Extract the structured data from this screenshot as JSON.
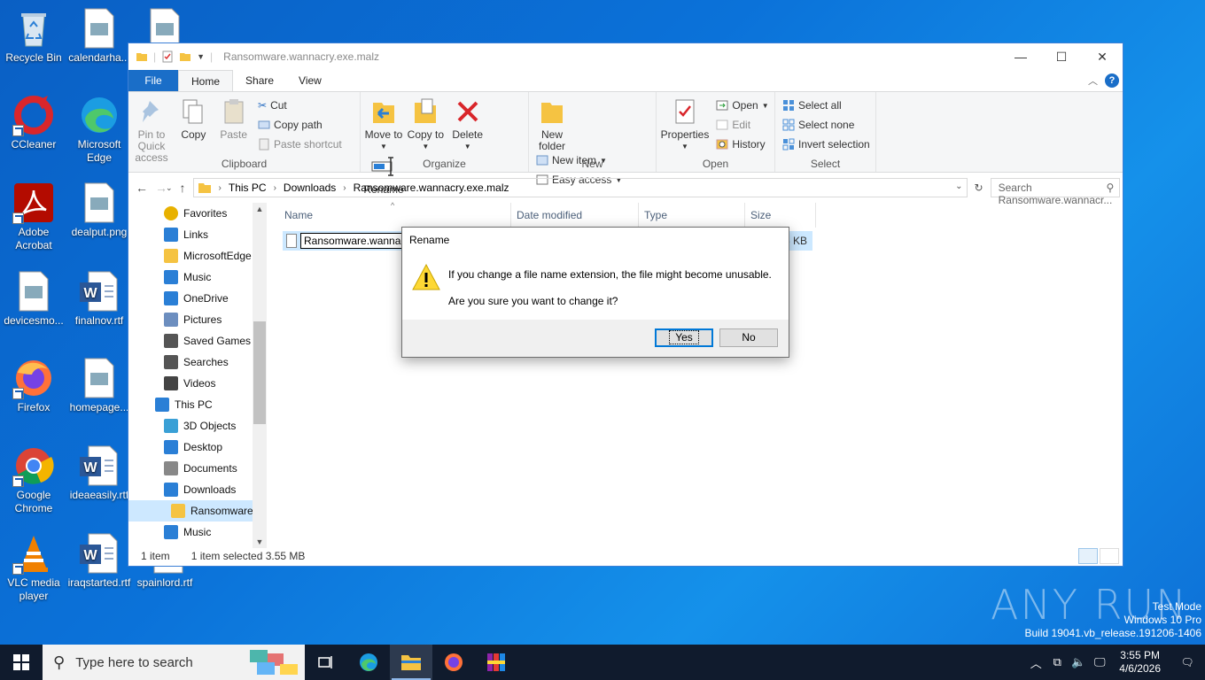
{
  "desktop": {
    "icons": [
      {
        "label": "Recycle Bin"
      },
      {
        "label": "calendarha..."
      },
      {
        "label": "CCleaner"
      },
      {
        "label": "Microsoft Edge"
      },
      {
        "label": "Adobe Acrobat"
      },
      {
        "label": "dealput.png"
      },
      {
        "label": "devicesmo..."
      },
      {
        "label": "finalnov.rtf"
      },
      {
        "label": "Firefox"
      },
      {
        "label": "homepage..."
      },
      {
        "label": "Google Chrome"
      },
      {
        "label": "ideaeasily.rtf"
      },
      {
        "label": "VLC media player"
      },
      {
        "label": "iraqstarted.rtf"
      },
      {
        "label": "spainlord.rtf"
      }
    ]
  },
  "explorer": {
    "title": "Ransomware.wannacry.exe.malz",
    "tabs": [
      "File",
      "Home",
      "Share",
      "View"
    ],
    "active_tab": "Home",
    "ribbon": {
      "clipboard": {
        "label": "Clipboard",
        "pin": "Pin to Quick access",
        "copy": "Copy",
        "paste": "Paste",
        "cut": "Cut",
        "copy_path": "Copy path",
        "paste_shortcut": "Paste shortcut"
      },
      "organize": {
        "label": "Organize",
        "move_to": "Move to",
        "copy_to": "Copy to",
        "delete": "Delete",
        "rename": "Rename"
      },
      "new": {
        "label": "New",
        "new_folder": "New folder",
        "new_item": "New item",
        "easy_access": "Easy access"
      },
      "open": {
        "label": "Open",
        "properties": "Properties",
        "open": "Open",
        "edit": "Edit",
        "history": "History"
      },
      "select": {
        "label": "Select",
        "select_all": "Select all",
        "select_none": "Select none",
        "invert": "Invert selection"
      }
    },
    "address": {
      "crumbs": [
        "This PC",
        "Downloads",
        "Ransomware.wannacry.exe.malz"
      ],
      "search_placeholder": "Search Ransomware.wannacr..."
    },
    "nav": {
      "items": [
        {
          "label": "Favorites",
          "icon": "star-icon",
          "indent": 1
        },
        {
          "label": "Links",
          "icon": "link-folder-icon",
          "indent": 1
        },
        {
          "label": "MicrosoftEdge",
          "icon": "folder-icon",
          "indent": 1
        },
        {
          "label": "Music",
          "icon": "music-icon",
          "indent": 1
        },
        {
          "label": "OneDrive",
          "icon": "cloud-icon",
          "indent": 1
        },
        {
          "label": "Pictures",
          "icon": "pictures-icon",
          "indent": 1
        },
        {
          "label": "Saved Games",
          "icon": "games-icon",
          "indent": 1
        },
        {
          "label": "Searches",
          "icon": "search-icon",
          "indent": 1
        },
        {
          "label": "Videos",
          "icon": "video-icon",
          "indent": 1
        },
        {
          "label": "This PC",
          "icon": "computer-icon",
          "indent": 0
        },
        {
          "label": "3D Objects",
          "icon": "cube-icon",
          "indent": 1
        },
        {
          "label": "Desktop",
          "icon": "desktop-icon",
          "indent": 1
        },
        {
          "label": "Documents",
          "icon": "documents-icon",
          "indent": 1
        },
        {
          "label": "Downloads",
          "icon": "download-icon",
          "indent": 1
        },
        {
          "label": "Ransomware.",
          "icon": "folder-icon",
          "indent": 2,
          "selected": true
        },
        {
          "label": "Music",
          "icon": "music-icon",
          "indent": 1
        }
      ]
    },
    "columns": [
      "Name",
      "Date modified",
      "Type",
      "Size"
    ],
    "file": {
      "name_edit": "Ransomware.wannacry",
      "size": "3,6 KB"
    },
    "status": {
      "count": "1 item",
      "selected": "1 item selected  3.55 MB"
    }
  },
  "dialog": {
    "title": "Rename",
    "line1": "If you change a file name extension, the file might become unusable.",
    "line2": "Are you sure you want to change it?",
    "yes": "Yes",
    "no": "No"
  },
  "watermark": {
    "text": "ANY RUN",
    "mode": "Test Mode",
    "edition": "Windows 10 Pro",
    "build": "Build 19041.vb_release.191206-1406"
  },
  "taskbar": {
    "search_placeholder": "Type here to search",
    "time": "3:55 PM",
    "date": "4/6/2026"
  },
  "colors": {
    "accent": "#1a6ec8",
    "selection": "#cce8ff",
    "taskbar": "#101b2d"
  }
}
